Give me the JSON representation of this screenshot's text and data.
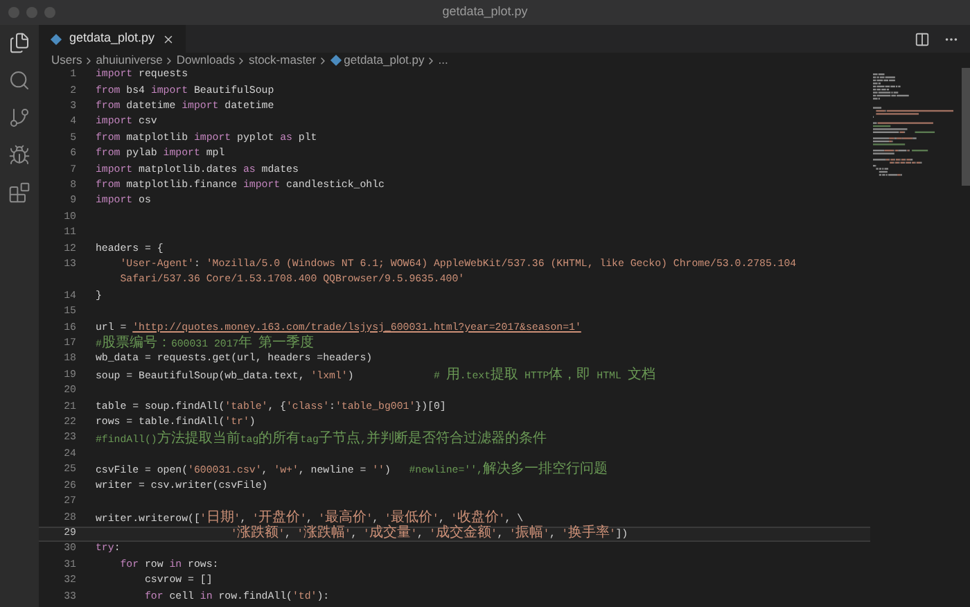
{
  "window": {
    "title": "getdata_plot.py"
  },
  "tabs": [
    {
      "label": "getdata_plot.py",
      "selected": true
    }
  ],
  "breadcrumbs": [
    {
      "label": "Users",
      "kind": "folder"
    },
    {
      "label": "ahuiuniverse",
      "kind": "folder"
    },
    {
      "label": "Downloads",
      "kind": "folder"
    },
    {
      "label": "stock-master",
      "kind": "folder"
    },
    {
      "label": "getdata_plot.py",
      "kind": "file"
    },
    {
      "label": "...",
      "kind": "more"
    }
  ],
  "editor": {
    "lines": [
      {
        "number": "1",
        "selected": false,
        "tokens": [
          {
            "kind": "kw",
            "text": "import"
          },
          {
            "kind": "plain",
            "text": " requests"
          }
        ]
      },
      {
        "number": "2",
        "selected": false,
        "tokens": [
          {
            "kind": "kw",
            "text": "from"
          },
          {
            "kind": "plain",
            "text": " bs4 "
          },
          {
            "kind": "kw",
            "text": "import"
          },
          {
            "kind": "plain",
            "text": " BeautifulSoup"
          }
        ]
      },
      {
        "number": "3",
        "selected": false,
        "tokens": [
          {
            "kind": "kw",
            "text": "from"
          },
          {
            "kind": "plain",
            "text": " datetime "
          },
          {
            "kind": "kw",
            "text": "import"
          },
          {
            "kind": "plain",
            "text": " datetime"
          }
        ]
      },
      {
        "number": "4",
        "selected": false,
        "tokens": [
          {
            "kind": "kw",
            "text": "import"
          },
          {
            "kind": "plain",
            "text": " csv"
          }
        ]
      },
      {
        "number": "5",
        "selected": false,
        "tokens": [
          {
            "kind": "kw",
            "text": "from"
          },
          {
            "kind": "plain",
            "text": " matplotlib "
          },
          {
            "kind": "kw",
            "text": "import"
          },
          {
            "kind": "plain",
            "text": " pyplot "
          },
          {
            "kind": "kw",
            "text": "as"
          },
          {
            "kind": "plain",
            "text": " plt"
          }
        ]
      },
      {
        "number": "6",
        "selected": false,
        "tokens": [
          {
            "kind": "kw",
            "text": "from"
          },
          {
            "kind": "plain",
            "text": " pylab "
          },
          {
            "kind": "kw",
            "text": "import"
          },
          {
            "kind": "plain",
            "text": " mpl"
          }
        ]
      },
      {
        "number": "7",
        "selected": false,
        "tokens": [
          {
            "kind": "kw",
            "text": "import"
          },
          {
            "kind": "plain",
            "text": " matplotlib.dates "
          },
          {
            "kind": "kw",
            "text": "as"
          },
          {
            "kind": "plain",
            "text": " mdates"
          }
        ]
      },
      {
        "number": "8",
        "selected": false,
        "tokens": [
          {
            "kind": "kw",
            "text": "from"
          },
          {
            "kind": "plain",
            "text": " matplotlib.finance "
          },
          {
            "kind": "kw",
            "text": "import"
          },
          {
            "kind": "plain",
            "text": " candlestick_ohlc"
          }
        ]
      },
      {
        "number": "9",
        "selected": false,
        "tokens": [
          {
            "kind": "kw",
            "text": "import"
          },
          {
            "kind": "plain",
            "text": " os"
          }
        ]
      },
      {
        "number": "10",
        "selected": false
      },
      {
        "number": "11",
        "selected": false
      },
      {
        "number": "12",
        "selected": false,
        "tokens": [
          {
            "kind": "plain",
            "text": "headers = {"
          }
        ]
      },
      {
        "number": "13",
        "selected": false,
        "tokens": [
          {
            "kind": "str",
            "text": "    'User-Agent'"
          },
          {
            "kind": "plain",
            "text": ": "
          },
          {
            "kind": "str",
            "text": "'Mozilla/5.0 (Windows NT 6.1; WOW64) AppleWebKit/537.36 (KHTML, like Gecko) Chrome/53.0.2785.104"
          }
        ]
      },
      {
        "selected": false,
        "tokens": [
          {
            "kind": "str",
            "text": "    Safari/537.36 Core/1.53.1708.400 QQBrowser/9.5.9635.400'"
          }
        ]
      },
      {
        "number": "14",
        "selected": false,
        "tokens": [
          {
            "kind": "plain",
            "text": "}"
          }
        ]
      },
      {
        "number": "15",
        "selected": false
      },
      {
        "number": "16",
        "selected": false,
        "tokens": [
          {
            "kind": "plain",
            "text": "url = "
          },
          {
            "kind": "link",
            "text": "'http://quotes.money.163.com/trade/lsjysj_600031.html?year=2017&season=1'"
          }
        ]
      },
      {
        "number": "17",
        "selected": false,
        "tokens": [
          {
            "kind": "comment",
            "text": "#股票编号：600031 2017年 第一季度"
          }
        ]
      },
      {
        "number": "18",
        "selected": false,
        "tokens": [
          {
            "kind": "plain",
            "text": "wb_data = requests.get(url, headers =headers)"
          }
        ]
      },
      {
        "number": "19",
        "selected": false,
        "tokens": [
          {
            "kind": "plain",
            "text": "soup = BeautifulSoup(wb_data.text, "
          },
          {
            "kind": "str",
            "text": "'lxml'"
          },
          {
            "kind": "plain",
            "text": ")             "
          },
          {
            "kind": "comment",
            "text": "# 用.text提取 HTTP体，即 HTML 文档"
          }
        ]
      },
      {
        "number": "20",
        "selected": false
      },
      {
        "number": "21",
        "selected": false,
        "tokens": [
          {
            "kind": "plain",
            "text": "table = soup.findAll("
          },
          {
            "kind": "str",
            "text": "'table'"
          },
          {
            "kind": "plain",
            "text": ", {"
          },
          {
            "kind": "str",
            "text": "'class'"
          },
          {
            "kind": "plain",
            "text": ":"
          },
          {
            "kind": "str",
            "text": "'table_bg001'"
          },
          {
            "kind": "plain",
            "text": "})[0]"
          }
        ]
      },
      {
        "number": "22",
        "selected": false,
        "tokens": [
          {
            "kind": "plain",
            "text": "rows = table.findAll("
          },
          {
            "kind": "str",
            "text": "'tr'"
          },
          {
            "kind": "plain",
            "text": ")"
          }
        ]
      },
      {
        "number": "23",
        "selected": false,
        "tokens": [
          {
            "kind": "comment",
            "text": "#findAll()方法提取当前tag的所有tag子节点,并判断是否符合过滤器的条件"
          }
        ]
      },
      {
        "number": "24",
        "selected": false
      },
      {
        "number": "25",
        "selected": false,
        "tokens": [
          {
            "kind": "plain",
            "text": "csvFile = open("
          },
          {
            "kind": "str",
            "text": "'600031.csv'"
          },
          {
            "kind": "plain",
            "text": ", "
          },
          {
            "kind": "str",
            "text": "'w+'"
          },
          {
            "kind": "plain",
            "text": ", newline = "
          },
          {
            "kind": "str",
            "text": "''"
          },
          {
            "kind": "plain",
            "text": ")   "
          },
          {
            "kind": "comment",
            "text": "#newline='',解决多一排空行问题"
          }
        ]
      },
      {
        "number": "26",
        "selected": false,
        "tokens": [
          {
            "kind": "plain",
            "text": "writer = csv.writer(csvFile)"
          }
        ]
      },
      {
        "number": "27",
        "selected": false
      },
      {
        "number": "28",
        "selected": false,
        "tokens": [
          {
            "kind": "plain",
            "text": "writer.writerow(["
          },
          {
            "kind": "str",
            "text": "'日期'"
          },
          {
            "kind": "plain",
            "text": ", "
          },
          {
            "kind": "str",
            "text": "'开盘价'"
          },
          {
            "kind": "plain",
            "text": ", "
          },
          {
            "kind": "str",
            "text": "'最高价'"
          },
          {
            "kind": "plain",
            "text": ", "
          },
          {
            "kind": "str",
            "text": "'最低价'"
          },
          {
            "kind": "plain",
            "text": ", "
          },
          {
            "kind": "str",
            "text": "'收盘价'"
          },
          {
            "kind": "plain",
            "text": ", \\"
          }
        ]
      },
      {
        "number": "29",
        "selected": true,
        "tokens": [
          {
            "kind": "str",
            "text": "                      '涨跌额'"
          },
          {
            "kind": "plain",
            "text": ", "
          },
          {
            "kind": "str",
            "text": "'涨跌幅'"
          },
          {
            "kind": "plain",
            "text": ", "
          },
          {
            "kind": "str",
            "text": "'成交量'"
          },
          {
            "kind": "plain",
            "text": ", "
          },
          {
            "kind": "str",
            "text": "'成交金额'"
          },
          {
            "kind": "plain",
            "text": ", "
          },
          {
            "kind": "str",
            "text": "'振幅'"
          },
          {
            "kind": "plain",
            "text": ", "
          },
          {
            "kind": "str",
            "text": "'换手率'"
          },
          {
            "kind": "plain",
            "text": "])"
          }
        ]
      },
      {
        "number": "30",
        "selected": false,
        "tokens": [
          {
            "kind": "kw",
            "text": "try"
          },
          {
            "kind": "plain",
            "text": ":"
          }
        ]
      },
      {
        "number": "31",
        "selected": false,
        "tokens": [
          {
            "kind": "kw",
            "text": "    for"
          },
          {
            "kind": "plain",
            "text": " row "
          },
          {
            "kind": "kw",
            "text": "in"
          },
          {
            "kind": "plain",
            "text": " rows:"
          }
        ]
      },
      {
        "number": "32",
        "selected": false,
        "tokens": [
          {
            "kind": "plain",
            "text": "        csvrow = []"
          }
        ]
      },
      {
        "number": "33",
        "selected": false,
        "tokens": [
          {
            "kind": "kw",
            "text": "        for"
          },
          {
            "kind": "plain",
            "text": " cell "
          },
          {
            "kind": "kw",
            "text": "in"
          },
          {
            "kind": "plain",
            "text": " row.findAll("
          },
          {
            "kind": "str",
            "text": "'td'"
          },
          {
            "kind": "plain",
            "text": "):"
          }
        ]
      }
    ]
  }
}
